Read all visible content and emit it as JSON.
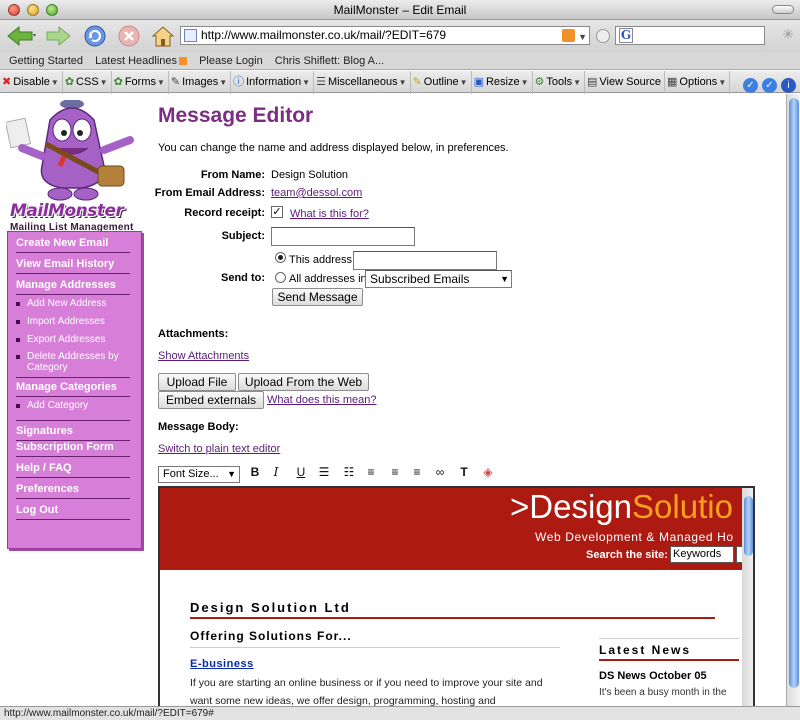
{
  "window": {
    "title": "MailMonster – Edit Email"
  },
  "browser": {
    "url": "http://www.mailmonster.co.uk/mail/?EDIT=679",
    "status": "http://www.mailmonster.co.uk/mail/?EDIT=679#",
    "search_engine_letter": "G",
    "bookmarks": [
      "Getting Started",
      "Latest Headlines",
      "Please Login",
      "Chris Shiflett: Blog A..."
    ],
    "devtools": [
      "Disable",
      "CSS",
      "Forms",
      "Images",
      "Information",
      "Miscellaneous",
      "Outline",
      "Resize",
      "Tools",
      "View Source",
      "Options"
    ]
  },
  "logo": {
    "wordmark": "MailMonster",
    "tagline": "Mailing List Management"
  },
  "sidebar": {
    "items": [
      {
        "label": "Create New Email"
      },
      {
        "label": "View Email History"
      },
      {
        "label": "Manage Addresses"
      },
      {
        "label": "Add New Address"
      },
      {
        "label": "Import Addresses"
      },
      {
        "label": "Export Addresses"
      },
      {
        "label": "Delete Addresses by Category"
      },
      {
        "label": "Manage Categories"
      },
      {
        "label": "Add Category"
      },
      {
        "label": "Signatures"
      },
      {
        "label": "Subscription Form"
      },
      {
        "label": "Help / FAQ"
      },
      {
        "label": "Preferences"
      },
      {
        "label": "Log Out"
      }
    ]
  },
  "main": {
    "title": "Message Editor",
    "intro": "You can change the name and address displayed below, in preferences.",
    "from_name_label": "From Name:",
    "from_name": "Design Solution",
    "from_email_label": "From Email Address:",
    "from_email": "team@dessol.com",
    "receipt_label": "Record receipt:",
    "receipt_checked": true,
    "receipt_help": "What is this for?",
    "subject_label": "Subject:",
    "subject_value": "",
    "send_to_label": "Send to:",
    "this_address_label": "This address:",
    "all_addresses_label": "All addresses in",
    "category_selected": "Subscribed Emails",
    "send_button": "Send Message",
    "attachments_label": "Attachments:",
    "show_attachments": "Show Attachments",
    "upload_file": "Upload File",
    "upload_web": "Upload From the Web",
    "embed_externals": "Embed externals",
    "embed_help": "What does this mean?",
    "body_label": "Message Body:",
    "switch_editor": "Switch to plain text editor",
    "font_size": "Font Size..."
  },
  "email_preview": {
    "logo_prefix": ">",
    "logo_white": "Design",
    "logo_orange": "Solutio",
    "tagline": "Web Development & Managed Ho",
    "search_label": "Search the site:",
    "search_value": "Keywords",
    "company": "Design Solution Ltd",
    "offering": "Offering Solutions For...",
    "ebusiness": "E-business",
    "paragraph": "If you are starting an online business or if you need to improve your site and want some new ideas, we offer design, programming, hosting and",
    "news_heading": "Latest News",
    "news_title": "DS News October 05",
    "news_body": "It's been a busy month in the"
  }
}
